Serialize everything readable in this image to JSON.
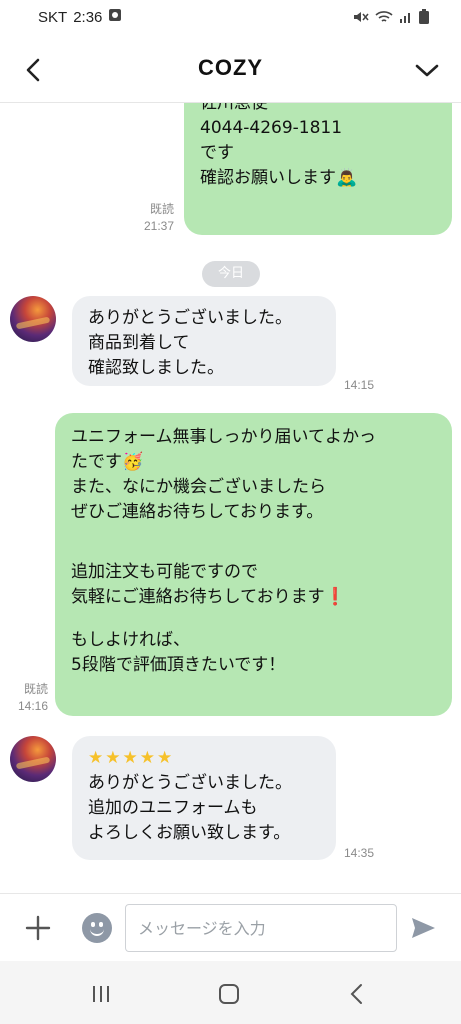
{
  "status": {
    "carrier": "SKT",
    "time": "2:36"
  },
  "header": {
    "title": "COZY"
  },
  "messages": [
    {
      "id": "m1",
      "from": "me",
      "lines": [
        "佐川急便",
        "4044-4269-1811",
        "です",
        "",
        "確認お願いします🙇‍♂️"
      ],
      "read": "既読",
      "time": "21:37"
    },
    {
      "id": "date",
      "label": "今日"
    },
    {
      "id": "m2",
      "from": "them",
      "lines": [
        "ありがとうございました。",
        "商品到着して",
        "確認致しました。"
      ],
      "time": "14:15"
    },
    {
      "id": "m3",
      "from": "me",
      "lines": [
        "ユニフォーム無事しっかり届いてよかっ",
        "たです🥳",
        "また、なにか機会ございましたら",
        "ぜひご連絡お待ちしております。",
        "",
        "",
        "追加注文も可能ですので",
        "気軽にご連絡お待ちしております❗",
        "",
        "もしよければ、",
        "5段階で評価頂きたいです！"
      ],
      "read": "既読",
      "time": "14:16"
    },
    {
      "id": "m4",
      "from": "them",
      "lines": [
        "★★★★★",
        "ありがとうございました。",
        "追加のユニフォームも",
        "よろしくお願い致します。"
      ],
      "time": "14:35"
    }
  ],
  "input": {
    "placeholder": "メッセージを入力"
  },
  "icons": {
    "back": "back-arrow-icon",
    "more": "chevron-down-icon",
    "plus": "plus-icon",
    "emoji": "emoji-icon",
    "send": "send-icon"
  },
  "colors": {
    "my_bubble": "#b6e7b3",
    "their_bubble": "#edeff2"
  }
}
